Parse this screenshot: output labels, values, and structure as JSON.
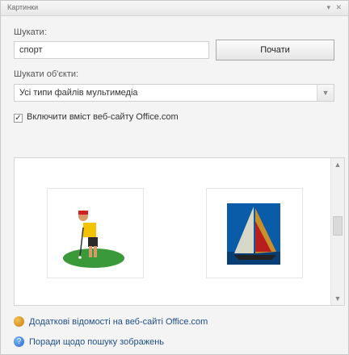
{
  "titlebar": {
    "title": "Картинки",
    "controls": "▾ ✕"
  },
  "search": {
    "label": "Шукати:",
    "value": "спорт",
    "go_label": "Почати"
  },
  "filter": {
    "label": "Шукати об'єкти:",
    "selected": "Усі типи файлів мультимедіа"
  },
  "office_content": {
    "label": "Включити вміст веб-сайту Office.com",
    "checked": true
  },
  "results": {
    "items": [
      {
        "name": "golfer-clipart"
      },
      {
        "name": "sailboat-clipart"
      }
    ]
  },
  "links": {
    "more_info": "Додаткові відомості на веб-сайті Office.com",
    "tips": "Поради щодо пошуку зображень"
  },
  "colors": {
    "link": "#1f4e8a",
    "field_border": "#cfcfcf"
  }
}
